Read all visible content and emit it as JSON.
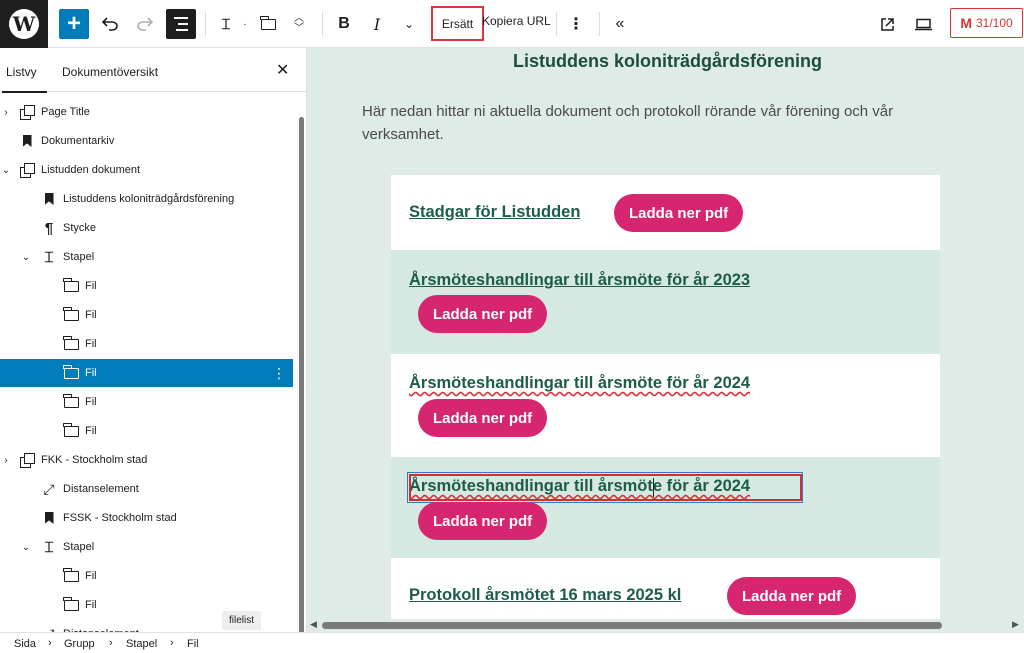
{
  "toolbar": {
    "ersatt_label": "Ersätt",
    "kopiera_label": "Kopiera URL",
    "counter": "31/100",
    "bold": "B",
    "italic": "I"
  },
  "sidebar": {
    "tab_listvy": "Listvy",
    "tab_dokument": "Dokumentöversikt",
    "tooltip": "filelist",
    "items": [
      {
        "label": "Page Title",
        "icon": "copy-icon",
        "depth": 0,
        "chevron": "right"
      },
      {
        "label": "Dokumentarkiv",
        "icon": "bookmark-icon",
        "depth": 0,
        "chevron": ""
      },
      {
        "label": "Listudden dokument",
        "icon": "copy-icon",
        "depth": 0,
        "chevron": "down"
      },
      {
        "label": "Listuddens koloniträdgårdsförening",
        "icon": "bookmark-icon",
        "depth": 1,
        "chevron": ""
      },
      {
        "label": "Stycke",
        "icon": "paragraph-icon",
        "depth": 1,
        "chevron": ""
      },
      {
        "label": "Stapel",
        "icon": "stack-icon",
        "depth": 1,
        "chevron": "down"
      },
      {
        "label": "Fil",
        "icon": "folder-icon",
        "depth": 2,
        "chevron": ""
      },
      {
        "label": "Fil",
        "icon": "folder-icon",
        "depth": 2,
        "chevron": ""
      },
      {
        "label": "Fil",
        "icon": "folder-icon",
        "depth": 2,
        "chevron": ""
      },
      {
        "label": "Fil",
        "icon": "folder-icon",
        "depth": 2,
        "chevron": "",
        "selected": true
      },
      {
        "label": "Fil",
        "icon": "folder-icon",
        "depth": 2,
        "chevron": ""
      },
      {
        "label": "Fil",
        "icon": "folder-icon",
        "depth": 2,
        "chevron": ""
      },
      {
        "label": "FKK - Stockholm stad",
        "icon": "copy-icon",
        "depth": 0,
        "chevron": "right"
      },
      {
        "label": "Distanselement",
        "icon": "resize-icon",
        "depth": 1,
        "chevron": ""
      },
      {
        "label": "FSSK - Stockholm stad",
        "icon": "bookmark-icon",
        "depth": 1,
        "chevron": ""
      },
      {
        "label": "Stapel",
        "icon": "stack-icon",
        "depth": 1,
        "chevron": "down"
      },
      {
        "label": "Fil",
        "icon": "folder-icon",
        "depth": 2,
        "chevron": ""
      },
      {
        "label": "Fil",
        "icon": "folder-icon",
        "depth": 2,
        "chevron": ""
      },
      {
        "label": "Distanselement",
        "icon": "resize-icon",
        "depth": 1,
        "chevron": ""
      }
    ]
  },
  "canvas": {
    "heading": "Listuddens koloniträdgårdsförening",
    "paragraph": "Här nedan hittar ni aktuella dokument och protokoll rörande vår förening och vår verksamhet.",
    "pdf_label": "Ladda ner pdf",
    "documents": [
      {
        "title": "Stadgar för Listudden"
      },
      {
        "title": "Årsmöteshandlingar till årsmöte för år 2023"
      },
      {
        "title": "Årsmöteshandlingar till årsmöte för år 2024"
      },
      {
        "title": "Årsmöteshandlingar till årsmöte för år 2024"
      },
      {
        "title": "Protokoll årsmötet 16 mars 2025 kl"
      }
    ]
  },
  "breadcrumb": [
    "Sida",
    "Grupp",
    "Stapel",
    "Fil"
  ],
  "colors": {
    "accent": "#007cba",
    "pdf_button": "#d6266f",
    "link": "#1d5c4a",
    "canvas_bg": "#dfebe6"
  }
}
